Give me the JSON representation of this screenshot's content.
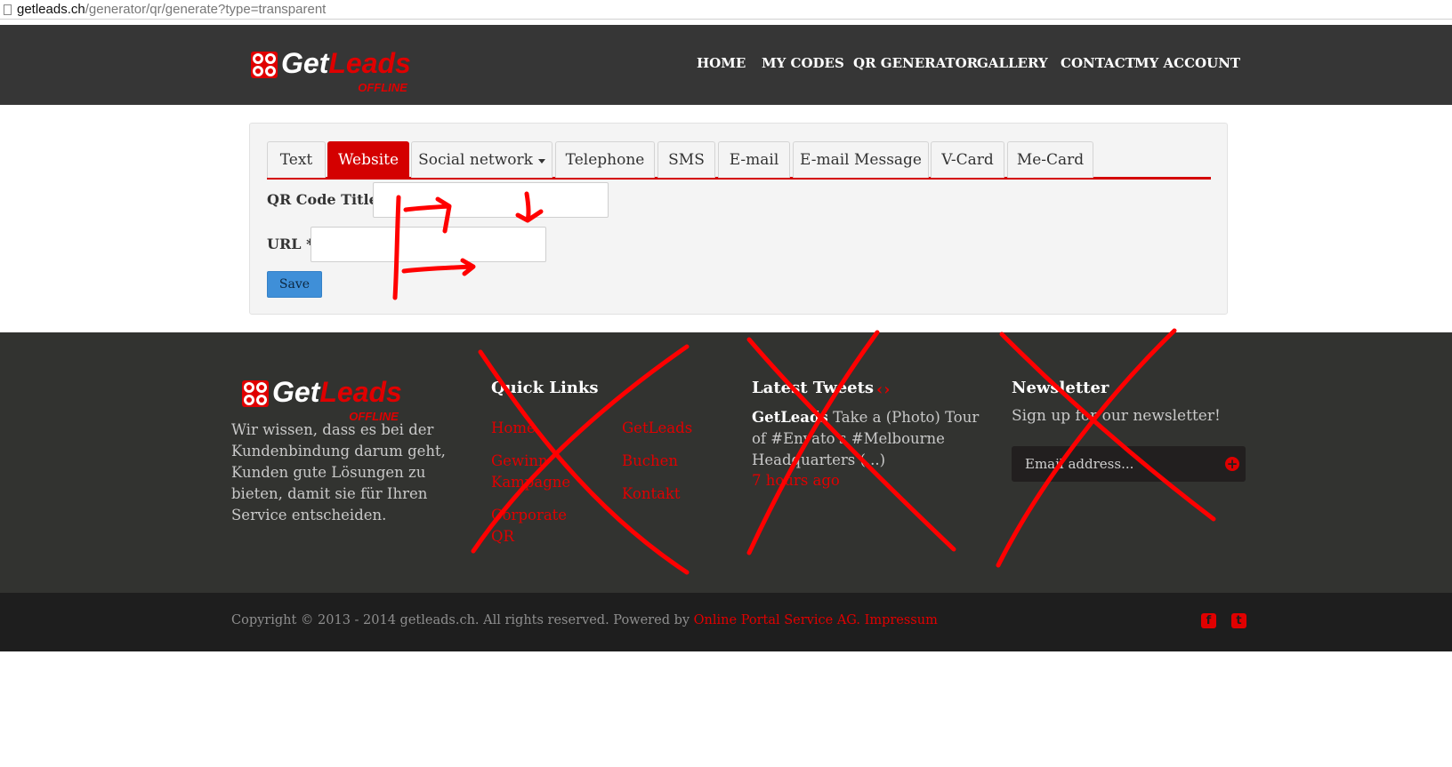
{
  "browser": {
    "url_domain": "getleads.ch",
    "url_path": "/generator/qr/generate?type=transparent"
  },
  "header": {
    "logo": {
      "get": "Get",
      "leads": "Leads",
      "offline": "OFFLINE"
    },
    "nav": [
      "HOME",
      "MY CODES",
      "QR GENERATOR",
      "GALLERY",
      "CONTACT",
      "MY ACCOUNT"
    ]
  },
  "generator": {
    "tabs": [
      "Text",
      "Website",
      "Social network",
      "Telephone",
      "SMS",
      "E-mail",
      "E-mail Message",
      "V-Card",
      "Me-Card"
    ],
    "active_tab": "Website",
    "form": {
      "title_label": "QR Code Title *",
      "title_value": "",
      "url_label": "URL *",
      "url_value": "",
      "save_label": "Save"
    }
  },
  "footer": {
    "about": "Wir wissen, dass es bei der Kundenbindung darum geht, Kunden gute Lösungen zu bieten, damit sie für Ihren Service entscheiden.",
    "quick_links": {
      "title": "Quick Links",
      "left": [
        "Home",
        "Gewinn Kampagne",
        "Corporate QR"
      ],
      "right": [
        "GetLeads",
        "Buchen",
        "Kontakt"
      ]
    },
    "tweets": {
      "title": "Latest Tweets",
      "arrows": "‹›",
      "author": "GetLeads",
      "text": "Take a (Photo) Tour of #Envato's #Melbourne Headquarters (...)",
      "time": "7 hours ago"
    },
    "newsletter": {
      "title": "Newsletter",
      "text": "Sign up for our newsletter!",
      "placeholder": "Email address..."
    }
  },
  "copyright": {
    "text": "Copyright © 2013 - 2014 getleads.ch. All rights reserved. Powered by ",
    "link1": "Online Portal Service AG.",
    "link2": "Impressum",
    "social": [
      "facebook-icon",
      "twitter-icon"
    ]
  },
  "colors": {
    "brand_red": "#e00000",
    "header_bg": "#363636",
    "footer_bg": "#323330",
    "copybar_bg": "#1e1e1e",
    "save_blue": "#3f8fd8",
    "annotation_red": "#ff0000"
  }
}
